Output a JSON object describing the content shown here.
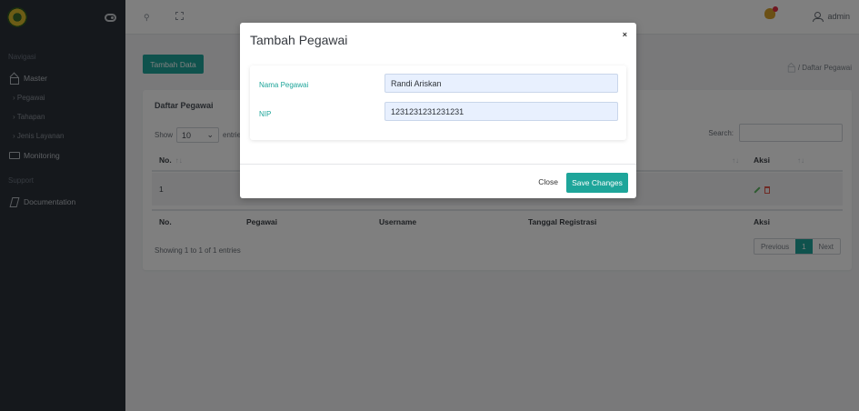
{
  "sidebar": {
    "navigasi_label": "Navigasi",
    "master_label": "Master",
    "submenu": [
      "› Pegawai",
      "› Tahapan",
      "› Jenis Layanan"
    ],
    "monitoring_label": "Monitoring",
    "support_label": "Support",
    "documentation_label": "Documentation"
  },
  "topbar": {
    "user_label": "admin"
  },
  "main": {
    "tambah_label": "Tambah Data",
    "breadcrumb": "/ Daftar Pegawai",
    "card_title": "Daftar Pegawai",
    "show_label": "Show",
    "show_value": "10",
    "entries_label": "entries",
    "search_label": "Search:",
    "columns": [
      "No.",
      "Pegawai",
      "Username",
      "Tanggal Registrasi",
      "Aksi"
    ],
    "rows": [
      {
        "no": "1"
      }
    ],
    "showing": "Showing 1 to 1 of 1 entries",
    "pager": {
      "prev": "Previous",
      "page": "1",
      "next": "Next"
    }
  },
  "modal": {
    "title": "Tambah Pegawai",
    "close_x": "×",
    "nama_label": "Nama Pegawai",
    "nama_value": "Randi Ariskan",
    "nip_label": "NIP",
    "nip_value": "1231231231231231",
    "close_label": "Close",
    "save_label": "Save Changes"
  },
  "colors": {
    "accent": "#1ea59a",
    "sidebar": "#2b3138"
  }
}
